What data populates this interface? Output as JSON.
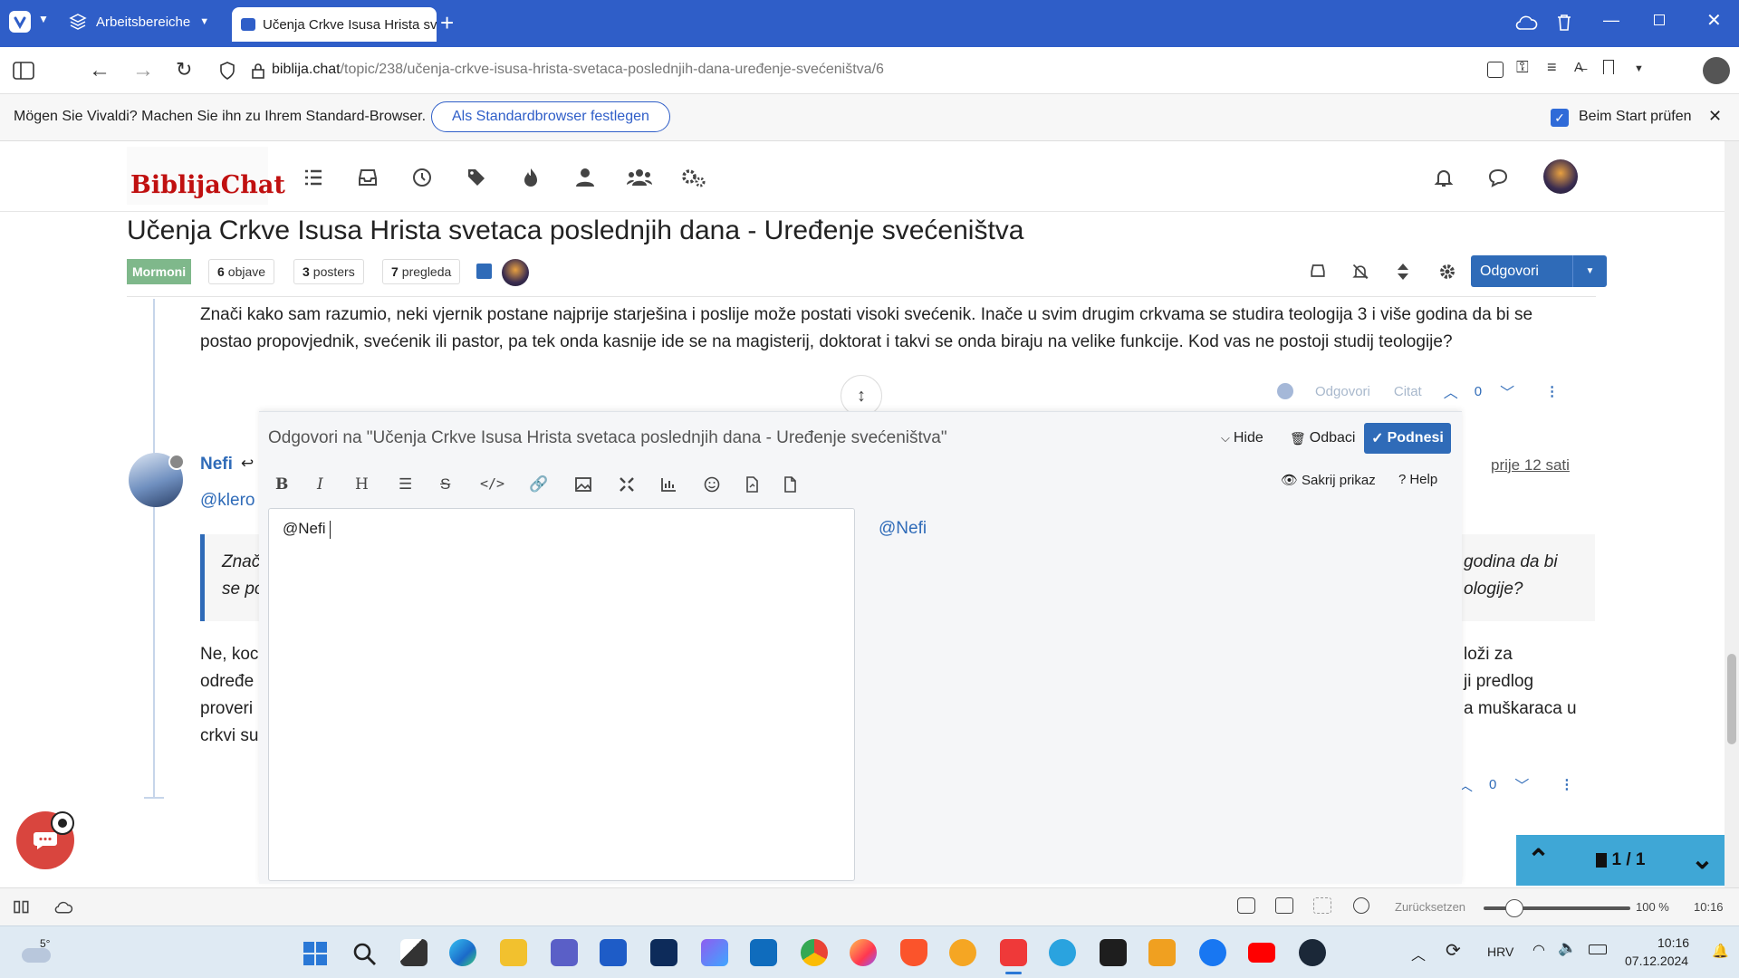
{
  "browser": {
    "workspaces_label": "Arbeitsbereiche",
    "tab_title": "Učenja Crkve Isusa Hrista svetaca poslednjih dana",
    "url_domain": "biblija.chat",
    "url_path": "/topic/238/učenja-crkve-isusa-hrista-svetaca-poslednjih-dana-uređenje-svećeništva/6",
    "notice_text": "Mögen Sie Vivaldi? Machen Sie ihn zu Ihrem Standard-Browser.",
    "notice_button": "Als Standardbrowser festlegen",
    "notice_checkbox": "Beim Start prüfen"
  },
  "forum": {
    "logo_text": "BiblijaChat",
    "topic_title": "Učenja Crkve Isusa Hrista svetaca poslednjih dana - Uređenje svećeništva",
    "category": "Mormoni",
    "posts_count": "6",
    "posts_label": "objave",
    "posters_count": "3",
    "posters_label": "posters",
    "views_count": "7",
    "views_label": "pregleda",
    "reply_button": "Odgovori"
  },
  "post1": {
    "text_line1": "Znači kako sam razumio, neki vjernik postane najprije starješina i poslije može postati visoki svećenik. Inače u svim drugim crkvama se studira teologija 3 i više godina da bi se",
    "text_line2": "postao propovjednik, svećenik ili pastor, pa tek onda kasnije ide se na magisterij, doktorat i takvi se onda biraju na velike funkcije. Kod vas ne postoji studij teologije?",
    "reply_link": "Odgovori",
    "quote_link": "Citat",
    "votes": "0"
  },
  "post2": {
    "author": "Nefi",
    "mention": "@klero",
    "timestamp": "prije 12 sati",
    "quote_left_1": "Znač",
    "quote_left_2": "se po",
    "quote_right_1": "godina da bi",
    "quote_right_2": "ologije?",
    "body_left_1": "Ne, koc",
    "body_left_2": "određe",
    "body_left_3": "proveri",
    "body_left_4": "crkvi su",
    "body_right_1": "loži za",
    "body_right_2": "ji predlog",
    "body_right_3": "a muškaraca u",
    "votes": "0"
  },
  "composer": {
    "title": "Odgovori na \"Učenja Crkve Isusa Hrista svetaca poslednjih dana - Uređenje svećeništva\"",
    "hide_label": "Hide",
    "discard_label": "Odbaci",
    "submit_label": "Podnesi",
    "hide_preview_label": "Sakrij prikaz",
    "help_label": "Help",
    "editor_text": "@Nefi",
    "preview_text": "@Nefi"
  },
  "pagination": {
    "label": "1 / 1"
  },
  "statusbar": {
    "reset_label": "Zurücksetzen",
    "zoom": "100 %",
    "time": "10:16"
  },
  "taskbar": {
    "weather": "5°",
    "language": "HRV",
    "time": "10:16",
    "date": "07.12.2024"
  }
}
